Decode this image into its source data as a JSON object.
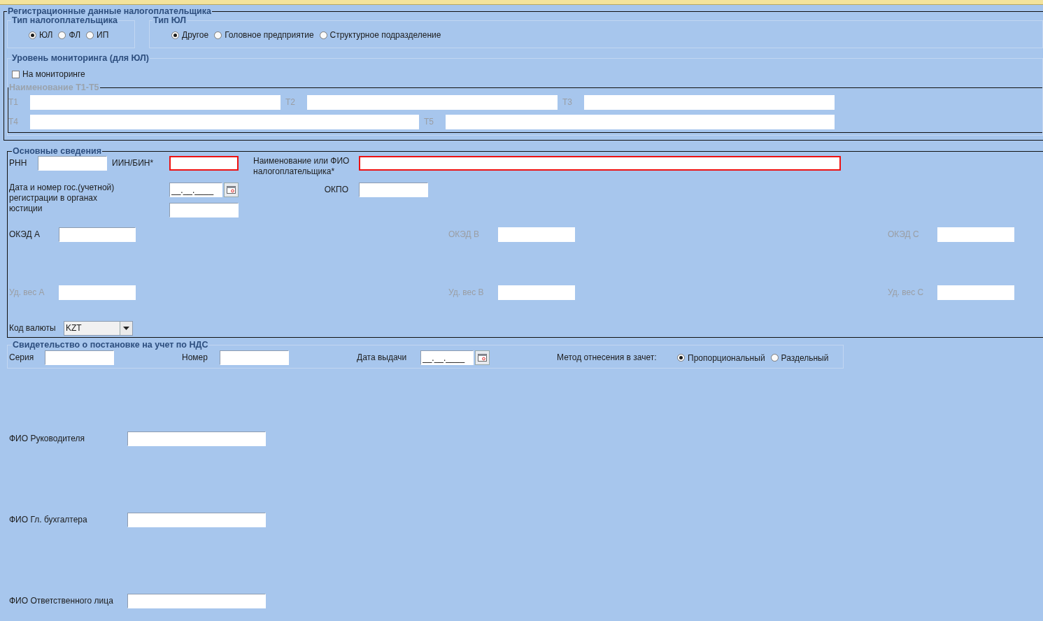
{
  "registration": {
    "title": "Регистрационные данные налогоплательщика",
    "taxpayer_type": {
      "title": "Тип налогоплательщика",
      "options": [
        {
          "label": "ЮЛ",
          "selected": true
        },
        {
          "label": "ФЛ",
          "selected": false
        },
        {
          "label": "ИП",
          "selected": false
        }
      ]
    },
    "legal_type": {
      "title": "Тип ЮЛ",
      "options": [
        {
          "label": "Другое",
          "selected": true
        },
        {
          "label": "Головное предприятие",
          "selected": false
        },
        {
          "label": "Структурное подразделение",
          "selected": false
        }
      ]
    },
    "monitoring": {
      "title": "Уровень мониторинга (для ЮЛ)",
      "checkbox": {
        "label": "На мониторинге",
        "checked": false
      }
    },
    "names": {
      "title": "Наименование Т1-Т5",
      "disabled": true,
      "rows": [
        [
          {
            "label": "Т1",
            "disabled": true
          },
          {
            "label": "Т2",
            "disabled": true
          },
          {
            "label": "Т3",
            "disabled": true
          }
        ],
        [
          {
            "label": "Т4",
            "disabled": true
          },
          {
            "label": "Т5",
            "disabled": true
          }
        ]
      ]
    }
  },
  "main_info": {
    "title": "Основные сведения",
    "rnn": {
      "label": "РНН",
      "invalid": false
    },
    "iin": {
      "label": "ИИН/БИН*",
      "invalid": true
    },
    "name": {
      "label": "Наименование или ФИО налогоплательщика*",
      "invalid": true
    },
    "registration": {
      "label": "Дата и номер гос.(учетной) регистрации в органах юстиции",
      "date": "__.__.____"
    },
    "okpo": {
      "label": "ОКПО"
    },
    "okved": [
      {
        "label": "ОКЭД А",
        "disabled": false
      },
      {
        "label": "ОКЭД В",
        "disabled": true
      },
      {
        "label": "ОКЭД С",
        "disabled": true
      }
    ],
    "weights": [
      {
        "label": "Уд. вес А",
        "disabled": true
      },
      {
        "label": "Уд. вес В",
        "disabled": true
      },
      {
        "label": "Уд. вес С",
        "disabled": true
      }
    ],
    "currency": {
      "label": "Код валюты",
      "value": "KZT"
    }
  },
  "vat_certificate": {
    "title": "Свидетельство о постановке на учет по НДС",
    "series": {
      "label": "Серия"
    },
    "number": {
      "label": "Номер"
    },
    "issue_date": {
      "label": "Дата выдачи",
      "value": "__.__.____"
    },
    "method": {
      "label": "Метод отнесения в зачет:",
      "options": [
        {
          "label": "Пропорциональный",
          "selected": true
        },
        {
          "label": "Раздельный",
          "selected": false
        }
      ]
    }
  },
  "officers": [
    {
      "label": "ФИО Руководителя"
    },
    {
      "label": "ФИО Гл. бухгалтера"
    },
    {
      "label": "ФИО Ответственного лица"
    }
  ]
}
